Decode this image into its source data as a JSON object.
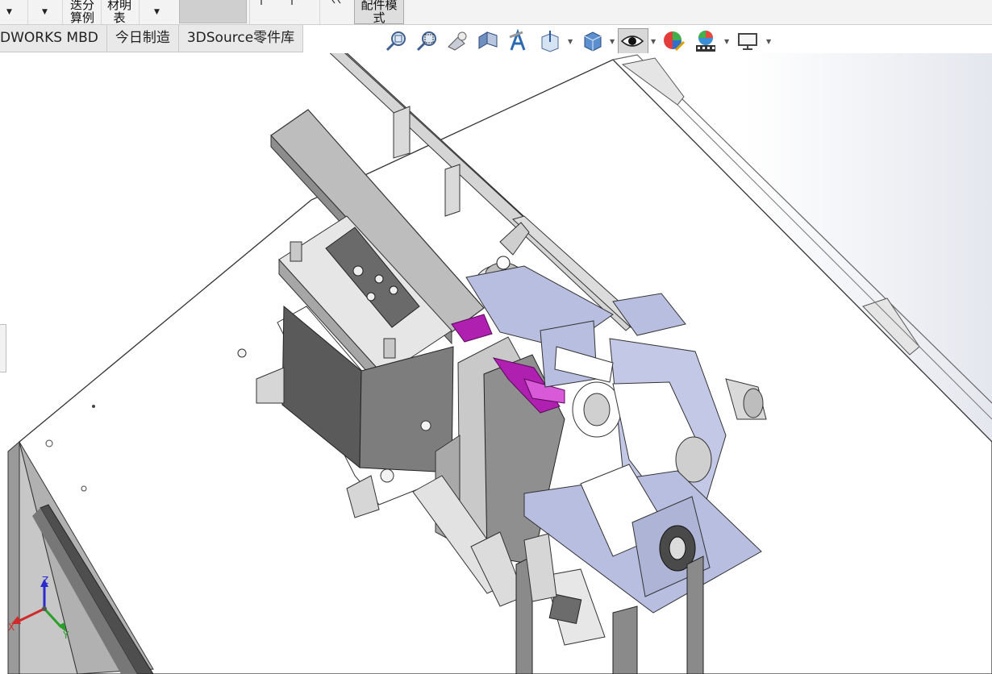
{
  "ribbon": {
    "items": [
      {
        "line1": "迭分",
        "line2": "算例"
      },
      {
        "line1": "材明",
        "line2": "表"
      },
      {
        "line1": "",
        "line2": "配件模"
      },
      {
        "line1": "",
        "line2": "式"
      }
    ]
  },
  "tabs": [
    {
      "label": "DWORKS MBD"
    },
    {
      "label": "今日制造"
    },
    {
      "label": "3DSource零件库"
    }
  ],
  "hud": {
    "icons": [
      "zoom-to-fit-icon",
      "zoom-to-area-icon",
      "previous-view-icon",
      "section-view-icon",
      "dynamic-annotation-icon",
      "view-orientation-icon",
      "display-style-icon",
      "hide-show-items-icon",
      "edit-appearance-icon",
      "apply-scene-icon",
      "view-settings-icon"
    ]
  },
  "triad": {
    "z": "Z",
    "x": "X",
    "y": "Y"
  },
  "colors": {
    "accent_magenta": "#b020b0",
    "part_blue": "#b8bedf",
    "steel_gray": "#8a8a8a"
  }
}
